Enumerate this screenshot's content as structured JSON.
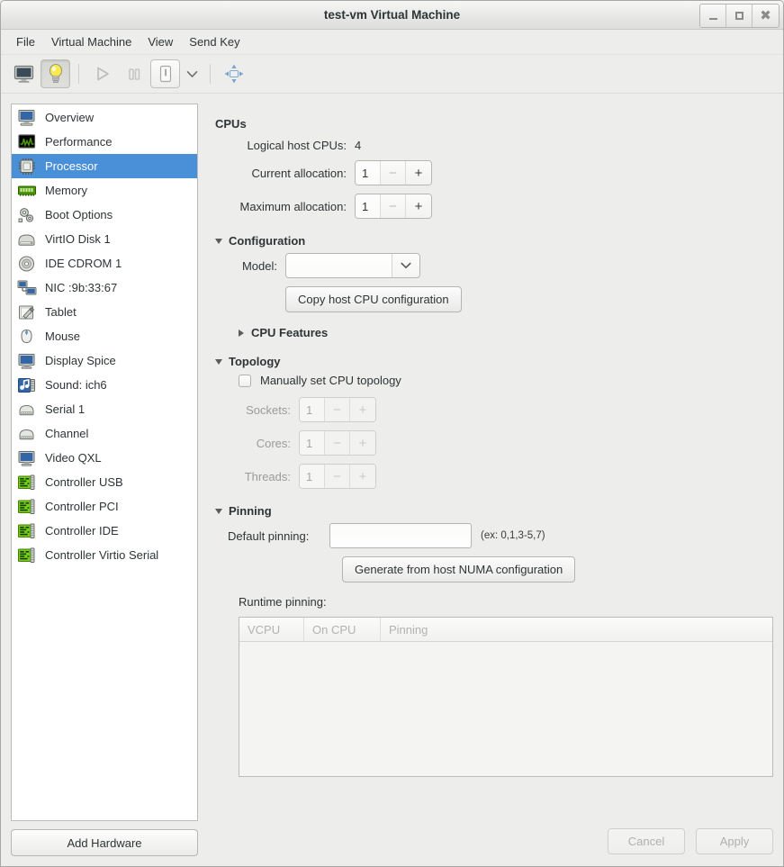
{
  "window": {
    "title": "test-vm Virtual Machine",
    "buttons": {
      "minimize": "minimize-icon",
      "maximize": "maximize-icon",
      "close": "close-icon"
    }
  },
  "menubar": {
    "items": [
      {
        "label": "File"
      },
      {
        "label": "Virtual Machine"
      },
      {
        "label": "View"
      },
      {
        "label": "Send Key"
      }
    ]
  },
  "toolbar": {
    "items": [
      {
        "name": "show-console-icon",
        "tooltip": "Console"
      },
      {
        "name": "show-details-icon",
        "tooltip": "Details",
        "active": true
      },
      {
        "name": "run-icon",
        "tooltip": "Run",
        "disabled": true
      },
      {
        "name": "pause-icon",
        "tooltip": "Pause",
        "disabled": true
      },
      {
        "name": "shutdown-icon",
        "tooltip": "Shut Down"
      },
      {
        "name": "chevron-down-icon",
        "tooltip": "Shutdown options"
      },
      {
        "name": "fullscreen-icon",
        "tooltip": "Fullscreen"
      }
    ]
  },
  "sidebar": {
    "items": [
      {
        "label": "Overview",
        "icon": "computer-icon"
      },
      {
        "label": "Performance",
        "icon": "chart-icon"
      },
      {
        "label": "Processor",
        "icon": "cpu-icon",
        "selected": true
      },
      {
        "label": "Memory",
        "icon": "memory-icon"
      },
      {
        "label": "Boot Options",
        "icon": "gears-icon"
      },
      {
        "label": "VirtIO Disk 1",
        "icon": "harddisk-icon"
      },
      {
        "label": "IDE CDROM 1",
        "icon": "cdrom-icon"
      },
      {
        "label": "NIC :9b:33:67",
        "icon": "network-icon"
      },
      {
        "label": "Tablet",
        "icon": "tablet-icon"
      },
      {
        "label": "Mouse",
        "icon": "mouse-icon"
      },
      {
        "label": "Display Spice",
        "icon": "display-icon"
      },
      {
        "label": "Sound: ich6",
        "icon": "sound-icon"
      },
      {
        "label": "Serial 1",
        "icon": "serial-icon"
      },
      {
        "label": "Channel",
        "icon": "serial-icon"
      },
      {
        "label": "Video QXL",
        "icon": "display-icon"
      },
      {
        "label": "Controller USB",
        "icon": "card-icon"
      },
      {
        "label": "Controller PCI",
        "icon": "card-icon"
      },
      {
        "label": "Controller IDE",
        "icon": "card-icon"
      },
      {
        "label": "Controller Virtio Serial",
        "icon": "card-icon"
      }
    ],
    "add_hardware_label": "Add Hardware"
  },
  "cpus": {
    "heading": "CPUs",
    "logical_host_label": "Logical host CPUs:",
    "logical_host_value": "4",
    "current_alloc_label": "Current allocation:",
    "current_alloc_value": "1",
    "maximum_alloc_label": "Maximum allocation:",
    "maximum_alloc_value": "1",
    "minus": "−",
    "plus": "+"
  },
  "configuration": {
    "heading": "Configuration",
    "model_label": "Model:",
    "model_value": "",
    "copy_host_cpu_label": "Copy host CPU configuration",
    "cpu_features_label": "CPU Features"
  },
  "topology": {
    "heading": "Topology",
    "manual_label": "Manually set CPU topology",
    "manual_checked": false,
    "sockets_label": "Sockets:",
    "sockets_value": "1",
    "cores_label": "Cores:",
    "cores_value": "1",
    "threads_label": "Threads:",
    "threads_value": "1"
  },
  "pinning": {
    "heading": "Pinning",
    "default_pinning_label": "Default pinning:",
    "default_pinning_value": "",
    "default_pinning_hint": "(ex: 0,1,3-5,7)",
    "generate_numa_label": "Generate from host NUMA configuration",
    "runtime_pinning_label": "Runtime pinning:",
    "table": {
      "columns": [
        "VCPU",
        "On CPU",
        "Pinning"
      ],
      "rows": []
    }
  },
  "footer": {
    "cancel_label": "Cancel",
    "apply_label": "Apply"
  },
  "colors": {
    "selection": "#4a90d9",
    "background": "#ededec",
    "list_background": "#ffffff",
    "text": "#2e3436",
    "disabled_text": "#b0b0ad"
  }
}
